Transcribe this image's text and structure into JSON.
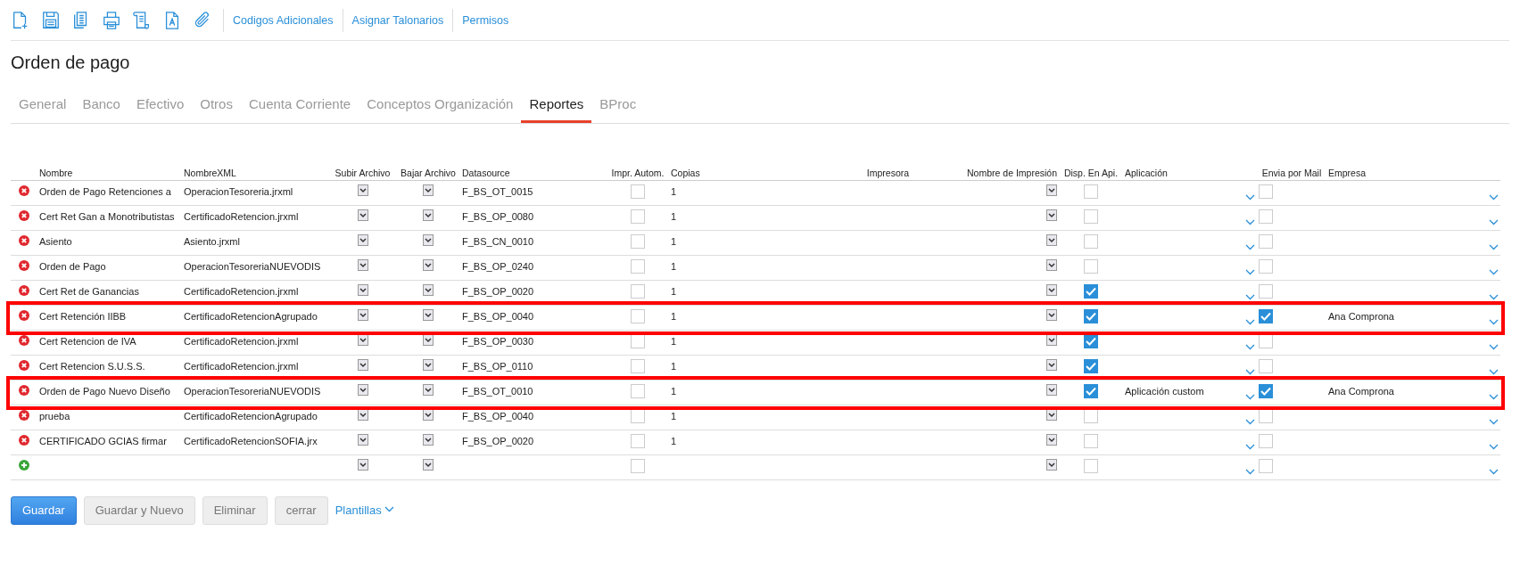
{
  "toolbar": {
    "links": [
      "Codigos Adicionales",
      "Asignar Talonarios",
      "Permisos"
    ]
  },
  "title": "Orden de pago",
  "tabs": [
    {
      "label": "General",
      "selected": false
    },
    {
      "label": "Banco",
      "selected": false
    },
    {
      "label": "Efectivo",
      "selected": false
    },
    {
      "label": "Otros",
      "selected": false
    },
    {
      "label": "Cuenta Corriente",
      "selected": false
    },
    {
      "label": "Conceptos Organización",
      "selected": false
    },
    {
      "label": "Reportes",
      "selected": true
    },
    {
      "label": "BProc",
      "selected": false
    }
  ],
  "table": {
    "columns": [
      "Nombre",
      "NombreXML",
      "Subir Archivo",
      "Bajar Archivo",
      "Datasource",
      "Impr. Autom.",
      "Copias",
      "Impresora",
      "Nombre de Impresión",
      "Disp. En Api.",
      "Aplicación",
      "Envia por Mail",
      "Empresa"
    ],
    "rows": [
      {
        "kind": "existing",
        "nombre": "Orden de Pago Retenciones a",
        "xml": "OperacionTesoreria.jrxml",
        "datasource": "F_BS_OT_0015",
        "impr_autom": false,
        "copias": "1",
        "disp_api": false,
        "envia_mail": false,
        "highlighted": false
      },
      {
        "kind": "existing",
        "nombre": "Cert Ret Gan a Monotributistas",
        "xml": "CertificadoRetencion.jrxml",
        "datasource": "F_BS_OP_0080",
        "impr_autom": false,
        "copias": "1",
        "disp_api": false,
        "envia_mail": false,
        "highlighted": false
      },
      {
        "kind": "existing",
        "nombre": "Asiento",
        "xml": "Asiento.jrxml",
        "datasource": "F_BS_CN_0010",
        "impr_autom": false,
        "copias": "1",
        "disp_api": false,
        "envia_mail": false,
        "highlighted": false
      },
      {
        "kind": "existing",
        "nombre": "Orden de Pago",
        "xml": "OperacionTesoreriaNUEVODIS",
        "datasource": "F_BS_OP_0240",
        "impr_autom": false,
        "copias": "1",
        "disp_api": false,
        "envia_mail": false,
        "highlighted": false
      },
      {
        "kind": "existing",
        "nombre": "Cert  Ret de Ganancias",
        "xml": "CertificadoRetencion.jrxml",
        "datasource": "F_BS_OP_0020",
        "impr_autom": false,
        "copias": "1",
        "disp_api": true,
        "envia_mail": false,
        "highlighted": false
      },
      {
        "kind": "existing",
        "nombre": "Cert Retención IIBB",
        "xml": "CertificadoRetencionAgrupado",
        "datasource": "F_BS_OP_0040",
        "impr_autom": false,
        "copias": "1",
        "disp_api": true,
        "envia_mail": true,
        "empresa": "Ana Comprona",
        "highlighted": true
      },
      {
        "kind": "existing",
        "nombre": "Cert Retencion de IVA",
        "xml": "CertificadoRetencion.jrxml",
        "datasource": "F_BS_OP_0030",
        "impr_autom": false,
        "copias": "1",
        "disp_api": true,
        "envia_mail": false,
        "highlighted": false
      },
      {
        "kind": "existing",
        "nombre": "Cert Retencion S.U.S.S.",
        "xml": "CertificadoRetencion.jrxml",
        "datasource": "F_BS_OP_0110",
        "impr_autom": false,
        "copias": "1",
        "disp_api": true,
        "envia_mail": false,
        "highlighted": false
      },
      {
        "kind": "existing",
        "nombre": "Orden de Pago Nuevo Diseño",
        "xml": "OperacionTesoreriaNUEVODIS",
        "datasource": "F_BS_OT_0010",
        "impr_autom": false,
        "copias": "1",
        "disp_api": true,
        "aplicacion": "Aplicación custom",
        "envia_mail": true,
        "empresa": "Ana Comprona",
        "highlighted": true
      },
      {
        "kind": "existing",
        "nombre": "prueba",
        "xml": "CertificadoRetencionAgrupado",
        "datasource": "F_BS_OP_0040",
        "impr_autom": false,
        "copias": "1",
        "disp_api": false,
        "envia_mail": false,
        "highlighted": false
      },
      {
        "kind": "existing",
        "nombre": "CERTIFICADO GCIAS firmar",
        "xml": "CertificadoRetencionSOFIA.jrx",
        "datasource": "F_BS_OP_0020",
        "impr_autom": false,
        "copias": "1",
        "disp_api": false,
        "envia_mail": false,
        "highlighted": false
      },
      {
        "kind": "new",
        "impr_autom": false,
        "disp_api": false,
        "envia_mail": false,
        "highlighted": false
      }
    ]
  },
  "buttons": [
    {
      "label": "Guardar",
      "kind": "primary"
    },
    {
      "label": "Guardar y Nuevo",
      "kind": "secondary"
    },
    {
      "label": "Eliminar",
      "kind": "secondary"
    },
    {
      "label": "cerrar",
      "kind": "secondary"
    },
    {
      "label": "Plantillas",
      "kind": "dropdown"
    }
  ]
}
